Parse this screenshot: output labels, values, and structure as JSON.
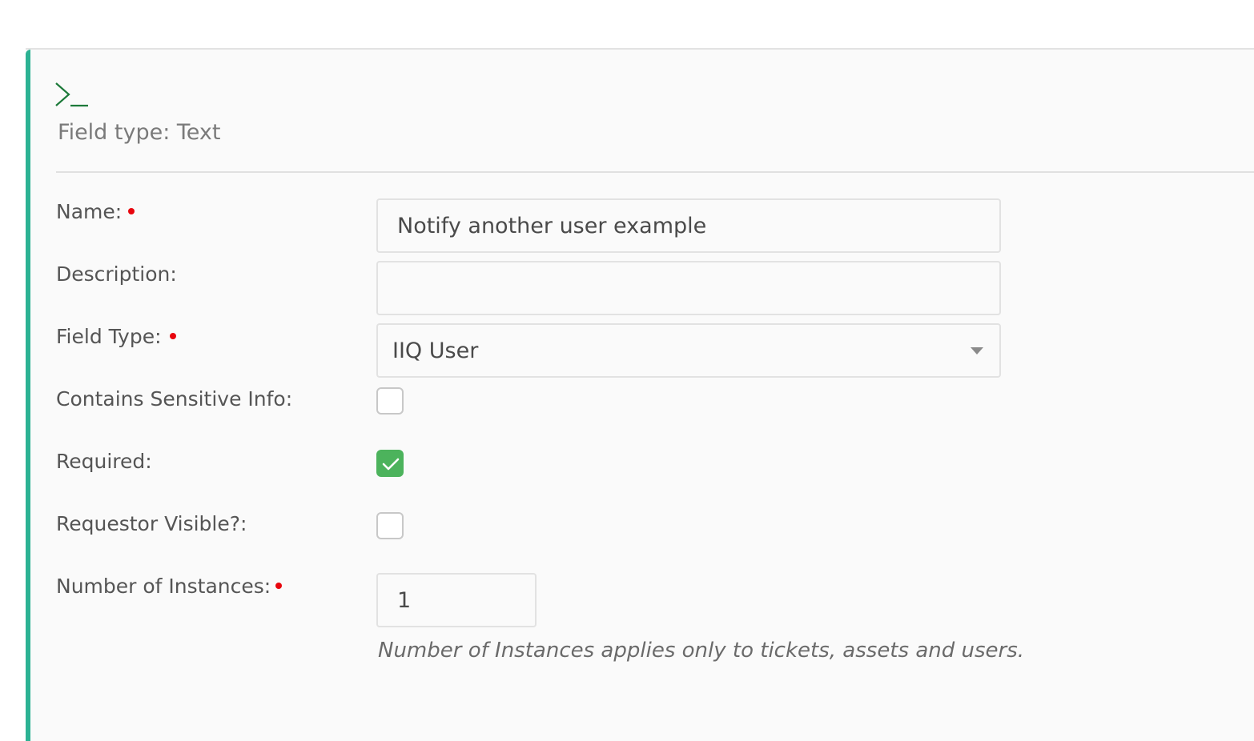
{
  "header": {
    "icon": "terminal-prompt-icon",
    "title": "Field type: Text"
  },
  "fields": {
    "name": {
      "label": "Name:",
      "required": true,
      "value": "Notify another user example"
    },
    "description": {
      "label": "Description:",
      "required": false,
      "value": ""
    },
    "field_type": {
      "label": "Field Type:",
      "required": true,
      "selected": "IIQ User"
    },
    "sensitive": {
      "label": "Contains Sensitive Info:",
      "checked": false
    },
    "required": {
      "label": "Required:",
      "checked": true
    },
    "requestor_visible": {
      "label": "Requestor Visible?:",
      "checked": false
    },
    "instances": {
      "label": "Number of Instances:",
      "required": true,
      "value": "1",
      "help": "Number of Instances applies only to tickets, assets and users."
    }
  },
  "colors": {
    "accent": "#2cb293",
    "required_dot": "#e8050d",
    "checkbox_checked": "#4cb35c"
  }
}
